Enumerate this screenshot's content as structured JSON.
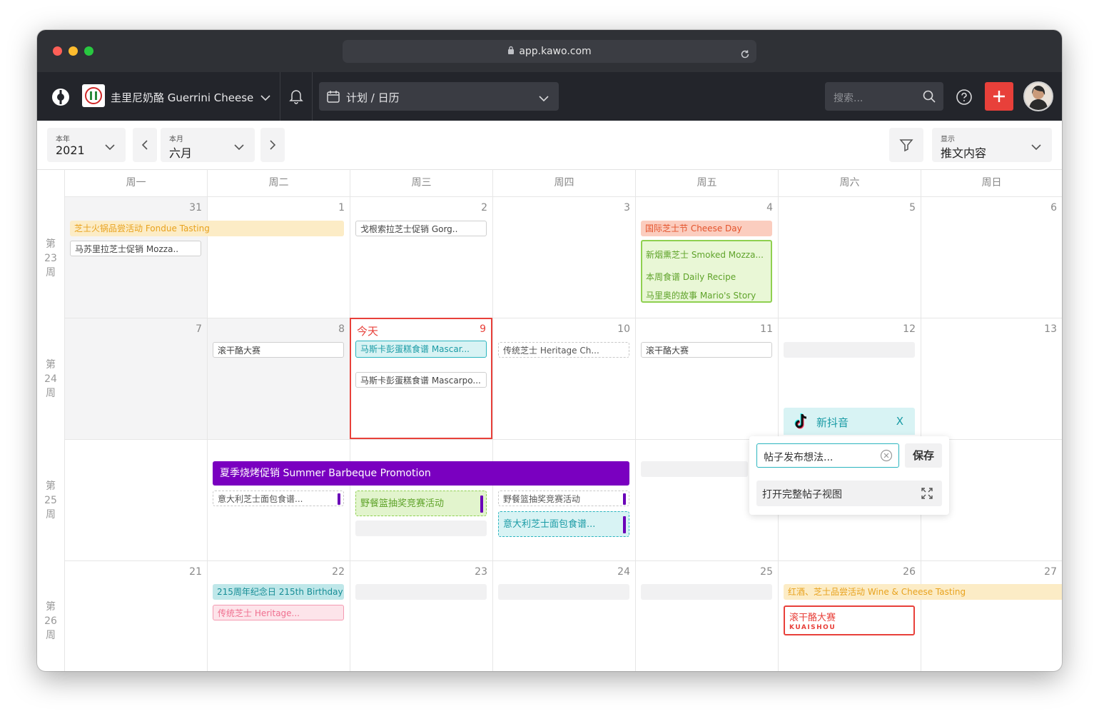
{
  "browser": {
    "url": "app.kawo.com"
  },
  "app": {
    "brand_name": "圭里尼奶酪 Guerrini Cheese",
    "view_name": "计划 / 日历",
    "search_placeholder": "搜索..."
  },
  "toolbar": {
    "year_label": "本年",
    "year_value": "2021",
    "month_label": "本月",
    "month_value": "六月",
    "display_label": "显示",
    "display_value": "推文内容"
  },
  "calendar": {
    "weekdays": [
      "周一",
      "周二",
      "周三",
      "周四",
      "周五",
      "周六",
      "周日"
    ],
    "weeks": [
      {
        "label_a": "第",
        "label_num": "23",
        "label_b": "周",
        "days": [
          "31",
          "1",
          "2",
          "3",
          "4",
          "5",
          "6"
        ]
      },
      {
        "label_a": "第",
        "label_num": "24",
        "label_b": "周",
        "days": [
          "7",
          "8",
          "9",
          "10",
          "11",
          "12",
          "13"
        ]
      },
      {
        "label_a": "第",
        "label_num": "25",
        "label_b": "周",
        "days": [
          "",
          "",
          "",
          "",
          "",
          "",
          ""
        ]
      },
      {
        "label_a": "第",
        "label_num": "26",
        "label_b": "周",
        "days": [
          "21",
          "22",
          "23",
          "24",
          "25",
          "26",
          "27"
        ]
      }
    ],
    "today_label": "今天",
    "events": {
      "fondue": "芝士火锅品尝活动 Fondue Tasting",
      "mozza": "马苏里拉芝士促销 Mozza..",
      "gorg": "戈根索拉芝士促销 Gorg..",
      "cheese_day": "国际芝士节 Cheese Day",
      "smoked": "新烟熏芝士 Smoked Mozza...",
      "daily_recipe": "本周食谱 Daily Recipe",
      "mario": "马里奥的故事 Mario's Story",
      "rolling_8": "滚干酪大赛",
      "masc_1": "马斯卡彭蛋糕食谱 Mascar...",
      "masc_2": "马斯卡彭蛋糕食谱 Mascarpo...",
      "heritage_10": "传统芝士 Heritage Ch...",
      "rolling_11": "滚干酪大赛",
      "bbq": "夏季烧烤促销 Summer Barbeque Promotion",
      "bread_a": "意大利芝士面包食谱...",
      "picnic_a": "野餐篮抽奖竞赛活动",
      "picnic_b": "野餐篮抽奖竞赛活动",
      "bread_b": "意大利芝士面包食谱...",
      "birthday": "215周年纪念日 215th Birthday",
      "heritage_22": "传统芝士 Heritage...",
      "wine": "红酒、芝士品尝活动 Wine & Cheese Tasting",
      "rolling_26": "滚干酪大赛",
      "kuaishou": "KUAISHOU"
    }
  },
  "popup": {
    "platform": "新抖音",
    "close_glyph": "X",
    "idea_placeholder": "帖子发布想法...",
    "save_label": "保存",
    "open_full_label": "打开完整帖子视图"
  },
  "colors": {
    "accent_red": "#e8403a",
    "bbq_purple": "#7a00c0",
    "teal": "#2bb5bf",
    "green": "#8fd050",
    "orange": "#f0a020"
  }
}
